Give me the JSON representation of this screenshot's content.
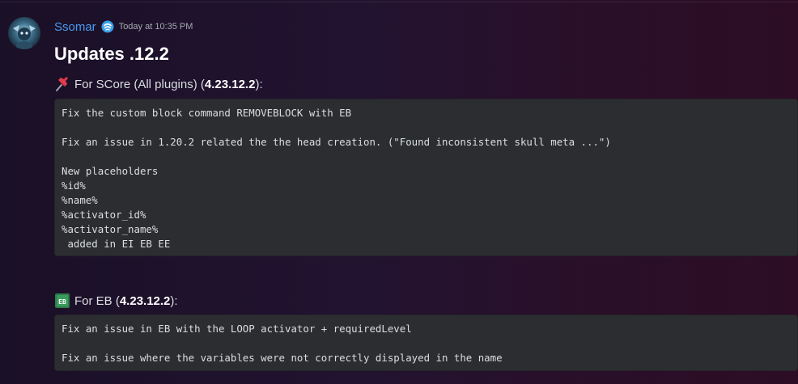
{
  "message": {
    "username": "Ssomar",
    "timestamp": "Today at 10:35 PM",
    "title": "Updates .12.2"
  },
  "score_section": {
    "prefix": "For SCore (All plugins) (",
    "version": "4.23.12.2",
    "suffix": "):",
    "emoji": "pushpin-icon",
    "code": "Fix the custom block command REMOVEBLOCK with EB\n\nFix an issue in 1.20.2 related the the head creation. (\"Found inconsistent skull meta ...\")\n\nNew placeholders\n%id%\n%name%\n%activator_id%\n%activator_name%\n added in EI EB EE"
  },
  "eb_section": {
    "prefix": "For EB (",
    "version": "4.23.12.2",
    "suffix": "):",
    "emoji": "eb-block-icon",
    "code": "Fix an issue in EB with the LOOP activator + requiredLevel\n\nFix an issue where the variables were not correctly displayed in the name"
  },
  "colors": {
    "username": "#4a9cf0",
    "code_background": "#2b2d31",
    "text": "#dbdee1"
  }
}
